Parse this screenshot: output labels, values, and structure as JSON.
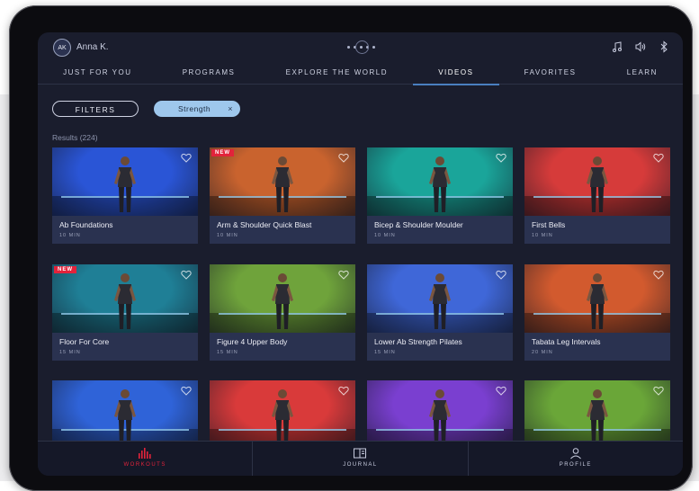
{
  "user": {
    "initials": "AK",
    "name": "Anna K."
  },
  "top_icons": [
    "music-icon",
    "volume-icon",
    "bluetooth-icon"
  ],
  "nav": {
    "tabs": [
      {
        "label": "JUST FOR YOU"
      },
      {
        "label": "PROGRAMS"
      },
      {
        "label": "EXPLORE THE WORLD"
      },
      {
        "label": "VIDEOS",
        "active": true
      },
      {
        "label": "FAVORITES"
      },
      {
        "label": "LEARN"
      }
    ]
  },
  "filters": {
    "button_label": "FILTERS",
    "active_chip": "Strength",
    "chip_close": "×"
  },
  "results_label": "Results (224)",
  "cards": [
    {
      "title": "Ab Foundations",
      "duration": "10 MIN",
      "new": false,
      "bg": "#2a55d6"
    },
    {
      "title": "Arm & Shoulder Quick Blast",
      "duration": "10 MIN",
      "new": true,
      "new_label": "NEW",
      "bg": "#c9632e"
    },
    {
      "title": "Bicep & Shoulder Moulder",
      "duration": "10 MIN",
      "new": false,
      "bg": "#1aa59a"
    },
    {
      "title": "First Bells",
      "duration": "10 MIN",
      "new": false,
      "bg": "#d63b3a"
    },
    {
      "title": "Floor For Core",
      "duration": "15 MIN",
      "new": true,
      "new_label": "NEW",
      "bg": "#1f7f96"
    },
    {
      "title": "Figure 4 Upper Body",
      "duration": "15 MIN",
      "new": false,
      "bg": "#6fa33b"
    },
    {
      "title": "Lower Ab Strength Pilates",
      "duration": "15 MIN",
      "new": false,
      "bg": "#3f67d8"
    },
    {
      "title": "Tabata Leg Intervals",
      "duration": "20 MIN",
      "new": false,
      "bg": "#d25a2e"
    },
    {
      "title": "",
      "duration": "",
      "new": false,
      "bg": "#2f63d8"
    },
    {
      "title": "",
      "duration": "",
      "new": false,
      "bg": "#d93a3a"
    },
    {
      "title": "",
      "duration": "",
      "new": false,
      "bg": "#7a3fd0"
    },
    {
      "title": "",
      "duration": "",
      "new": false,
      "bg": "#6aa638"
    }
  ],
  "bottom_nav": [
    {
      "label": "WORKOUTS",
      "icon": "workouts-bars-icon",
      "active": true
    },
    {
      "label": "JOURNAL",
      "icon": "journal-icon"
    },
    {
      "label": "PROFILE",
      "icon": "profile-icon"
    }
  ],
  "colors": {
    "accent_red": "#e2233b",
    "chip_blue": "#9ec7ec",
    "screen_bg": "#1a1d2d",
    "card_bg": "#2a3250"
  }
}
